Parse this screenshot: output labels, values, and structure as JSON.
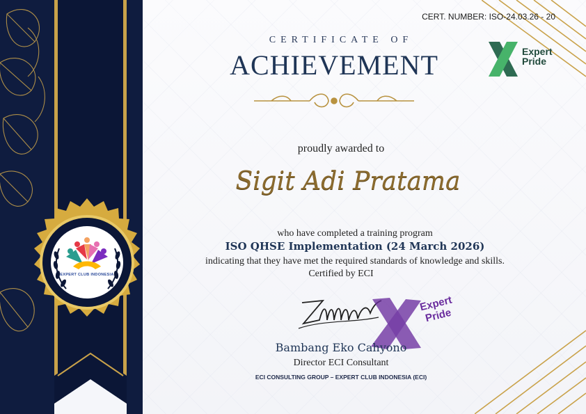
{
  "certificate": {
    "number_label": "CERT. NUMBER: ISO-24.03.26 - 20",
    "title_small": "CERTIFICATE OF",
    "title_big": "ACHIEVEMENT",
    "awarded_text": "proudly awarded to",
    "recipient_name": "Sigit Adi Pratama",
    "completed_text": "who have completed a training program",
    "program_name": "ISO QHSE Implementation (24 March 2026)",
    "standards_text": "indicating that they have met the required standards of knowledge and skills.",
    "certified_by": "Certified by ECI",
    "signer_name": "Bambang Eko Cahyono",
    "signer_role": "Director ECI Consultant",
    "organization": "ECI CONSULTING GROUP – EXPERT CLUB INDONESIA (ECI)"
  },
  "logo": {
    "line1": "Expert",
    "line2": "Pride"
  },
  "stamp": {
    "line1": "Expert",
    "line2": "Pride"
  },
  "medal": {
    "text": "EXPERT CLUB INDONESIA"
  },
  "colors": {
    "navy": "#13224a",
    "gold": "#c9a24a",
    "title": "#1f3556",
    "name_gold": "#8a6a2e",
    "stamp_purple": "#6a2d9e",
    "logo_green": "#214a3c"
  }
}
